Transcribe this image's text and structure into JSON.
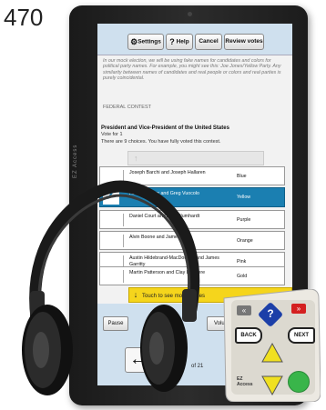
{
  "figure_number": "470",
  "device_text": "EZ Access",
  "toolbar": {
    "settings": "Settings",
    "help": "Help",
    "cancel": "Cancel",
    "review": "Review votes"
  },
  "notice": {
    "text": "In our mock election, we will be using fake names for candidates and colors for political party names. For example, you might see this: Joe Jones/Yellow Party. Any similarity between names of candidates and real people or colors and real parties is purely coincidental.",
    "contest_label": "FEDERAL CONTEST"
  },
  "contest": {
    "title": "President and Vice-President of the United States",
    "vote_for": "Vote for 1",
    "status": "There are 9 choices. You have fully voted this contest."
  },
  "candidates": [
    {
      "name": "Joseph Barchi and Joseph Hallaren",
      "party": "Blue",
      "selected": false
    },
    {
      "name": "Adam Cramer and Greg Vuocolo",
      "party": "Yellow",
      "selected": true
    },
    {
      "name": "Daniel Court and Amy Blumhardt",
      "party": "Purple",
      "selected": false
    },
    {
      "name": "Alvin Boone and James Lian",
      "party": "Orange",
      "selected": false
    },
    {
      "name": "Austin Hildebrand-MacDougall and James Garritty",
      "party": "Pink",
      "selected": false
    },
    {
      "name": "Martin Patterson and Clay Lariviere",
      "party": "Gold",
      "selected": false
    }
  ],
  "touch_more": "Touch to see more names",
  "bottom": {
    "pause": "Pause",
    "volume": "Volume",
    "page_of": "of 21"
  },
  "controller": {
    "back": "BACK",
    "next": "NEXT",
    "help_symbol": "?",
    "brand_line": "EZ Access"
  },
  "colors": {
    "selected_row": "#1b7fb1",
    "toolbar_bg": "#cfe0ee",
    "touch_more_bg": "#f5d51c",
    "help_button": "#1c3fa8",
    "red_button": "#d42020",
    "yellow_arrow": "#f0e020",
    "green_button": "#39b54a"
  }
}
